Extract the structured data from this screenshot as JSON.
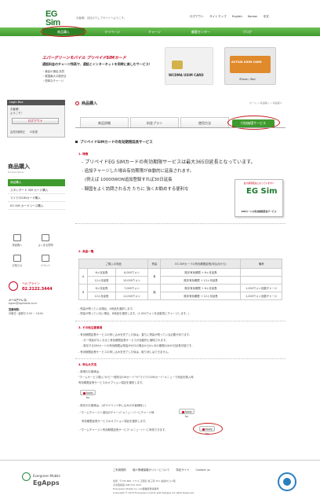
{
  "header": {
    "logo_brand": "EG Sim",
    "logo_sub": "Evergreen mobile CARD",
    "tagline": "お客様！当社のウェブサイトへようこそ。",
    "links": [
      "ログアウト",
      "サイトマップ",
      "English",
      "Korean",
      "中文"
    ]
  },
  "nav": [
    "商品購入",
    "マイページ",
    "チャージ",
    "顧客センター",
    "ブログ"
  ],
  "hero": {
    "title": "エバーグリーンモバイル プリペイドSIMカード",
    "subtitle": "通話料金のチャージ残高で、通話とインターネットを同時に楽しむサービス！",
    "bullets": [
      "・最高の通話 品質",
      "・韓国最大の販売店",
      "・簡単なチャージ"
    ],
    "card1_title": "WCDMA USIM CARD",
    "card2_title": "ACTIVA USIM CARD",
    "card2_sub": "iPhone / iPad"
  },
  "sidebar": {
    "login_title": "Login Box",
    "login_msg": "お客様！\nようこそ！",
    "logout": "ログアウト",
    "links_small": [
      "会員情報修正",
      "ID変更"
    ],
    "section_title": "商品購入",
    "section_en": "Product Store",
    "items": [
      "商品購入",
      "スタンダード SIM カード購入",
      "マイクロSIMカード購入",
      "EG SIM カードリース購入"
    ],
    "icons": [
      "商品購入",
      "よくある質問",
      "お知らせ",
      "イベント"
    ],
    "help_title": "ヘルプライン",
    "help_phone": "02.2122.3444",
    "email_label": "メールアドレス:",
    "email": "egsim@egmobile.co.kr",
    "office_label": "営業時間:",
    "office": "月曜日~金曜日 9:30 ~ 18:00"
  },
  "content": {
    "heading": "商品購入",
    "breadcrumb": "ホーム > 商品購入 > 商品紹介",
    "tabs": [
      "商品詳細",
      "料金プラン",
      "使用方法",
      "付加価値サービス"
    ],
    "section_title": "プリペイドSIMカードの有効期限延長サービス",
    "s1": "1. 特徴",
    "s1_lines": [
      "- プリペイドEG SIMカードの有効期限サービスは最大365日延長となっています。",
      "- 追加チャージした場合有効期限が自動的に延長されます。",
      "(例えば 10000WON追加登録すれば30日延長",
      "- 韓国をよく訪問される方 たちに 強くお勧めする便利な"
    ],
    "promo_label": "最大期間延長となっています!!",
    "promo_brand": "EG Sim",
    "promo_caption": "SIMカードの有効期間延長サービス",
    "s2": "2. 商品一覧",
    "table_headers": [
      "ご購入の商品",
      "残高",
      "EG SIMカードの有効期限延長(申込月から)",
      "備考"
    ],
    "table_rows": [
      [
        "A",
        "6ヶ月延長",
        "6,000ウォン",
        "有",
        "既存有効期限 + 6ヶ月延長",
        ""
      ],
      [
        "",
        "12ヶ月延長",
        "10,000ウォン",
        "",
        "既存有効期限 + 12ヶ月延長",
        ""
      ],
      [
        "B",
        "6ヶ月延長",
        "7,000ウォン",
        "無",
        "既存有効期限 + 6ヶ月延長",
        "1,000ウォン自動チャージ"
      ],
      [
        "",
        "12ヶ月延長",
        "11,000ウォン",
        "",
        "既存有効期限 + 12ヶ月延長",
        "1,000ウォン自動チャージ"
      ]
    ],
    "notes2": [
      "- 残高が残っている場合、A商品を選択します。",
      "- 残高が残っていない場合、B商品を選択します。(1,000ウォンを自動的にチャージします。)"
    ],
    "s3": "3. その他注意事項",
    "notes3": [
      "- 有効期限延長サービスの申し込みを完了した後は、直ちに残高が残っている必要があります。",
      "- 万一残高がなくなると有効期限延長サービスが自動的に解除されます。",
      "- 既存するSIMカードの有効期限は残高がゼロの場合から6ヶ月の期間のみ45日延長可能です。",
      "- 有効期限延長サービスの申し込みを完了した後は、取り消しはできません。"
    ],
    "s4": "4. 申込み方法",
    "notes4": [
      "- 新規のお客様は、",
      "\"ホームサービス購入\"から\"一般的なSIMカード\"や\"マイクロSIMカード\"メニューで商品を購入時",
      "有効期限延長サービスのオプション項目を選択します。"
    ],
    "apply_label": "Apply for",
    "notes4b": [
      "- 既存のお客様は、(ATOイベント申し込みのお客様除く)",
      "- \"ホームチャージ＞追加のチャージ\"メニューバーにチャージ時",
      "有効期限延長サービスのオプション項目を選択します。",
      "- \"ホームチャージ＞有効期限延長サービス\"メニューバーに申請できます。"
    ]
  },
  "footer": {
    "links": [
      "ご利用規約",
      "個人情報保護ポリシーについて",
      "特定サイト",
      "Contact us"
    ],
    "brand_small": "Evergreen Mobile",
    "brand_big": "EgApps",
    "address": [
      "住所: 〒135-881 ソウル 江南区 新三洞 701 電話8ビル1階",
      "大表取締役 KIM KYU SOO",
      "Evergreen Mobile Co.,Ltd事業者登録番号",
      "Copyright © 2013 Evergreen mobile with EgApps all rights Reserved."
    ]
  },
  "colors": {
    "brand_green": "#3f9a2e",
    "accent_red": "#c8001e"
  }
}
